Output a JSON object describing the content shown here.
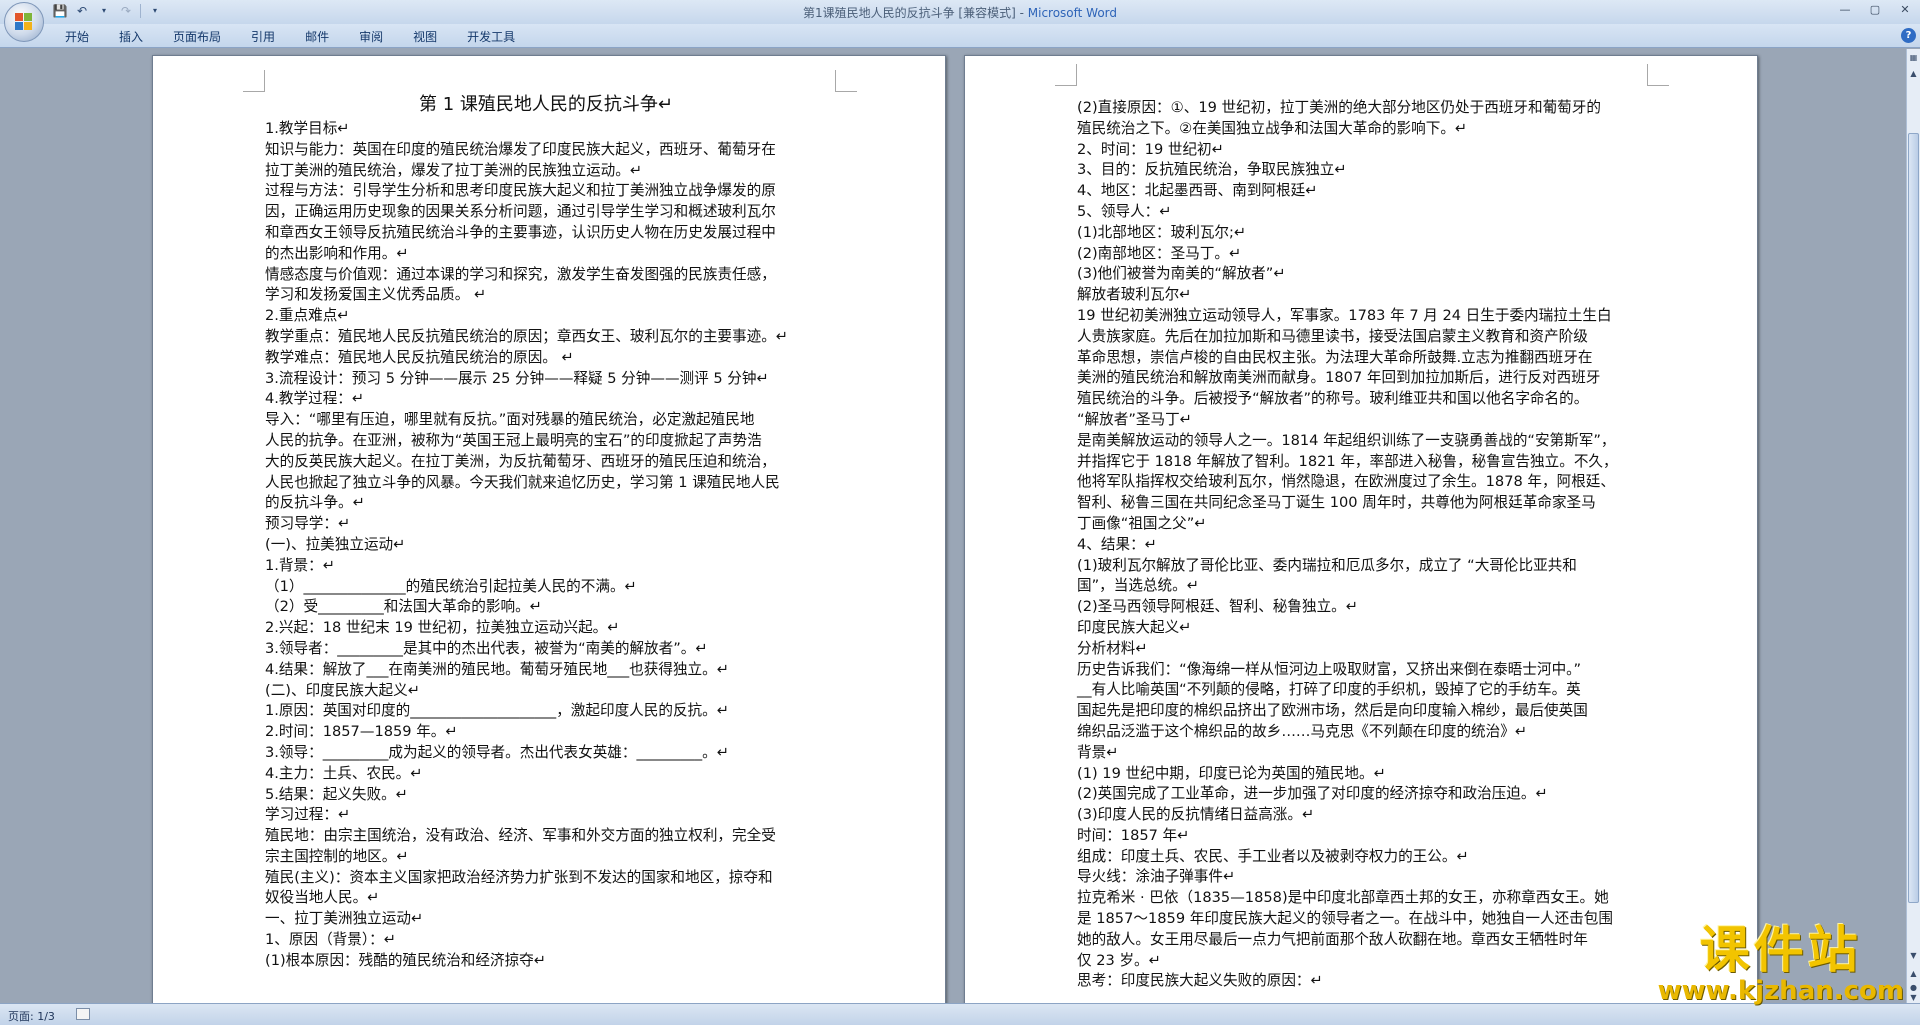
{
  "window": {
    "title": "第1课殖民地人民的反抗斗争 [兼容模式] - ",
    "app_name": "Microsoft Word",
    "controls": [
      "—",
      "▢",
      "✕"
    ]
  },
  "ribbon": {
    "tabs": [
      "开始",
      "插入",
      "页面布局",
      "引用",
      "邮件",
      "审阅",
      "视图",
      "开发工具"
    ],
    "help": "?"
  },
  "status": {
    "page": "页面: 1/3"
  },
  "watermark": {
    "main": "课件站",
    "url": "www.kjzhan.com"
  },
  "document": {
    "left_page": [
      "第 1 课殖民地人民的反抗斗争↵",
      "1.教学目标↵",
      "知识与能力：英国在印度的殖民统治爆发了印度民族大起义，西班牙、葡萄牙在",
      "拉丁美洲的殖民统治，爆发了拉丁美洲的民族独立运动。↵",
      "过程与方法：引导学生分析和思考印度民族大起义和拉丁美洲独立战争爆发的原",
      "因，正确运用历史现象的因果关系分析问题，通过引导学生学习和概述玻利瓦尔",
      "和章西女王领导反抗殖民统治斗争的主要事迹，认识历史人物在历史发展过程中",
      "的杰出影响和作用。↵",
      "情感态度与价值观：通过本课的学习和探究，激发学生奋发图强的民族责任感，",
      "学习和发扬爱国主义优秀品质。 ↵",
      "2.重点难点↵",
      "教学重点：殖民地人民反抗殖民统治的原因；章西女王、玻利瓦尔的主要事迹。↵",
      "教学难点：殖民地人民反抗殖民统治的原因。 ↵",
      "3.流程设计：预习 5 分钟——展示 25 分钟——释疑 5 分钟——测评 5 分钟↵",
      "4.教学过程：↵",
      "导入：“哪里有压迫，哪里就有反抗。”面对残暴的殖民统治，必定激起殖民地",
      "人民的抗争。在亚洲，被称为“英国王冠上最明亮的宝石”的印度掀起了声势浩",
      "大的反英民族大起义。在拉丁美洲，为反抗葡萄牙、西班牙的殖民压迫和统治，",
      "人民也掀起了独立斗争的风暴。今天我们就来追忆历史，学习第 1 课殖民地人民",
      "的反抗斗争。↵",
      "预习导学：↵",
      "(一)、拉美独立运动↵",
      "1.背景：↵",
      "（1）______________的殖民统治引起拉美人民的不满。↵",
      "（2）受_________和法国大革命的影响。↵",
      "2.兴起：18 世纪末 19 世纪初，拉美独立运动兴起。↵",
      "3.领导者：_________是其中的杰出代表，被誉为“南美的解放者”。↵",
      "4.结果：解放了___在南美洲的殖民地。葡萄牙殖民地___也获得独立。↵",
      "(二)、印度民族大起义↵",
      "1.原因：英国对印度的____________________，激起印度人民的反抗。↵",
      "2.时间：1857—1859 年。↵",
      "3.领导：_________成为起义的领导者。杰出代表女英雄：_________。↵",
      "4.主力：土兵、农民。↵",
      "5.结果：起义失败。↵",
      "学习过程：↵",
      "殖民地：由宗主国统治，没有政治、经济、军事和外交方面的独立权利，完全受",
      "宗主国控制的地区。↵",
      "殖民(主义)：资本主义国家把政治经济势力扩张到不发达的国家和地区，掠夺和",
      "奴役当地人民。↵",
      "一、拉丁美洲独立运动↵",
      "1、原因（背景）：↵",
      "(1)根本原因：残酷的殖民统治和经济掠夺↵"
    ],
    "right_page": [
      "(2)直接原因：①、19 世纪初，拉丁美洲的绝大部分地区仍处于西班牙和葡萄牙的",
      "殖民统治之下。②在美国独立战争和法国大革命的影响下。↵",
      "2、时间：19 世纪初↵",
      "3、目的：反抗殖民统治，争取民族独立↵",
      "4、地区：北起墨西哥、南到阿根廷↵",
      "5、领导人：↵",
      "(1)北部地区：玻利瓦尔;↵",
      "(2)南部地区：圣马丁。↵",
      "(3)他们被誉为南美的“解放者”↵",
      "解放者玻利瓦尔↵",
      "19 世纪初美洲独立运动领导人，军事家。1783 年 7 月 24 日生于委内瑞拉土生白",
      "人贵族家庭。先后在加拉加斯和马德里读书，接受法国启蒙主义教育和资产阶级",
      "革命思想，崇信卢梭的自由民权主张。为法理大革命所鼓舞.立志为推翻西班牙在",
      "美洲的殖民统治和解放南美洲而献身。1807 年回到加拉加斯后，进行反对西班牙",
      "殖民统治的斗争。后被授予“解放者”的称号。玻利维亚共和国以他名字命名的。",
      "“解放者”圣马丁↵",
      "是南美解放运动的领导人之一。1814 年起组织训练了一支骁勇善战的“安第斯军”，",
      "并指挥它于 1818 年解放了智利。1821 年，率部进入秘鲁，秘鲁宣告独立。不久，",
      "他将军队指挥权交给玻利瓦尔，悄然隐退，在欧洲度过了余生。1878 年，阿根廷、",
      "智利、秘鲁三国在共同纪念圣马丁诞生 100 周年时，共尊他为阿根廷革命家圣马",
      "丁画像“祖国之父”↵",
      "4、结果：↵",
      "(1)玻利瓦尔解放了哥伦比亚、委内瑞拉和厄瓜多尔，成立了 “大哥伦比亚共和",
      "国”，当选总统。↵",
      "(2)圣马西领导阿根廷、智利、秘鲁独立。↵",
      "印度民族大起义↵",
      "分析材料↵",
      "历史告诉我们：“像海绵一样从恒河边上吸取财富，又挤出来倒在泰晤士河中。”",
      "__有人比喻英国“不列颠的侵略，打碎了印度的手织机，毁掉了它的手纺车。英",
      "国起先是把印度的棉织品挤出了欧洲市场，然后是向印度输入棉纱，最后使英国",
      "绵织品泛滥于这个棉织品的故乡……马克思《不列颠在印度的统治》↵",
      "背景↵",
      "(1) 19 世纪中期，印度已论为英国的殖民地。↵",
      "(2)英国完成了工业革命，进一步加强了对印度的经济掠夺和政治压迫。↵",
      "(3)印度人民的反抗情绪日益高涨。↵",
      "时间：1857 年↵",
      "组成：印度土兵、农民、手工业者以及被剥夺权力的王公。↵",
      "导火线：涂油子弹事件↵",
      "拉克希米 · 巴依（1835—1858)是中印度北部章西土邦的女王，亦称章西女王。她",
      "是 1857～1859 年印度民族大起义的领导者之一。在战斗中，她独自一人还击包围",
      "她的敌人。女王用尽最后一点力气把前面那个敌人砍翻在地。章西女王牺牲时年",
      "仅 23 岁。↵",
      "思考：印度民族大起义失败的原因：↵"
    ]
  }
}
